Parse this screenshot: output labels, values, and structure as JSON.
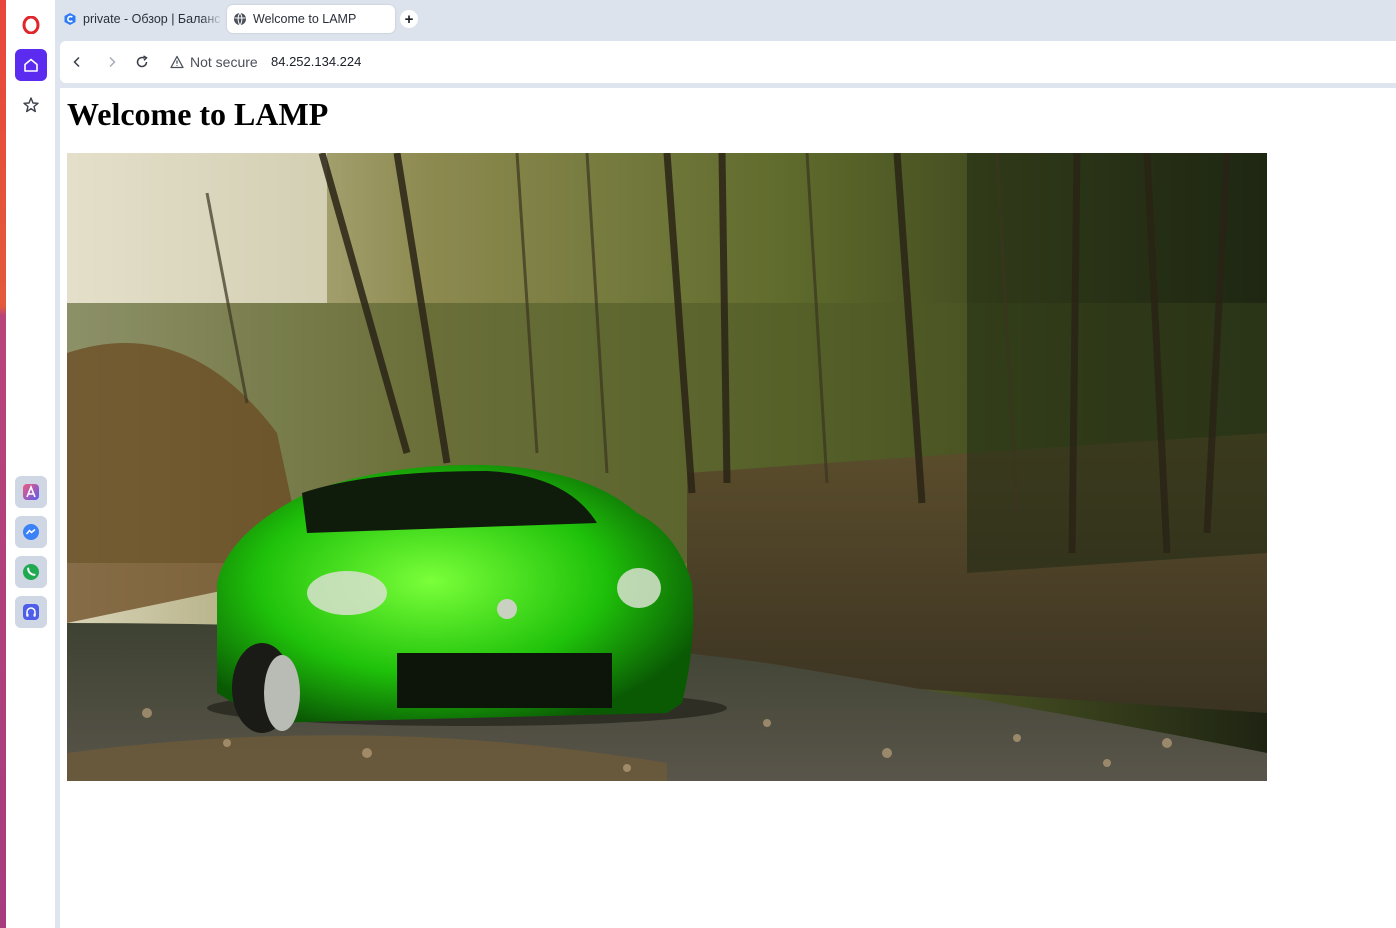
{
  "browser": {
    "tabs": [
      {
        "label": "private - Обзор | Баланс",
        "favicon": "blue-c-icon",
        "active": false
      },
      {
        "label": "Welcome to LAMP",
        "favicon": "globe-icon",
        "active": true
      }
    ],
    "new_tab_label": "+",
    "security_label": "Not secure",
    "url": "84.252.134.224"
  },
  "sidebar": {
    "items": [
      "opera-logo-icon",
      "home-icon",
      "star-icon",
      "aria-icon",
      "messenger-icon",
      "whatsapp-icon",
      "player-icon"
    ],
    "accent": "#5b2cf0"
  },
  "page": {
    "heading": "Welcome to LAMP",
    "image_alt": "green sports car on a forest road"
  },
  "colors": {
    "stripe_top": "#e8463c",
    "stripe_bottom": "#a63c7e",
    "tabbar": "#dde3ed"
  }
}
